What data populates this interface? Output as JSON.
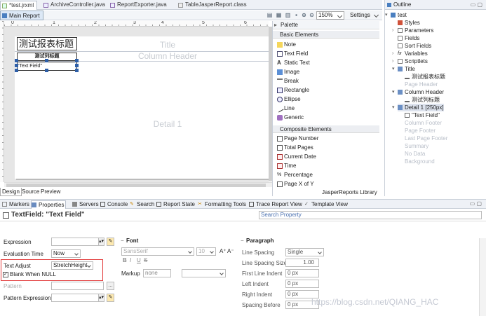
{
  "editor_tabs": [
    "*test.jrxml",
    "ArchiveController.java",
    "ReportExporter.java",
    "TableJasperReport.class"
  ],
  "sub_tab": "Main Report",
  "toolbar": {
    "zoom": "150%",
    "settings": "Settings"
  },
  "ruler": {
    "marks": [
      "0",
      "1",
      "2",
      "3",
      "4",
      "5",
      "6"
    ]
  },
  "report": {
    "title_text": "测试报表标题",
    "column_header_text": "测试列标题",
    "text_field": "\"Text Field\"",
    "bands": {
      "title": "Title",
      "column_header": "Column Header",
      "detail": "Detail 1"
    }
  },
  "bottom_tabs": [
    "Design",
    "Source",
    "Preview"
  ],
  "palette": {
    "header": "Palette",
    "basic_section": "Basic Elements",
    "basic": [
      "Note",
      "Text Field",
      "Static Text",
      "Image",
      "Break",
      "Rectangle",
      "Ellipse",
      "Line",
      "Generic"
    ],
    "composite_section": "Composite Elements",
    "composite": [
      "Page Number",
      "Total Pages",
      "Current Date",
      "Time",
      "Percentage",
      "Page X of Y"
    ],
    "footer": "JasperReports Library"
  },
  "outline": {
    "header": "Outline",
    "root": "test",
    "items": [
      "Styles",
      "Parameters",
      "Fields",
      "Sort Fields",
      "Variables",
      "Scriptlets",
      "Title",
      "测试报表标题",
      "Page Header",
      "Column Header",
      "测试列标题",
      "Detail 1 [250px]",
      "\"Text Field\"",
      "Column Footer",
      "Page Footer",
      "Last Page Footer",
      "Summary",
      "No Data",
      "Background"
    ]
  },
  "views": [
    "Markers",
    "Properties",
    "Servers",
    "Console",
    "Search",
    "Report State",
    "Formatting Tools",
    "Trace Report View",
    "Template View"
  ],
  "properties": {
    "title": "TextField: \"Text Field\"",
    "search_placeholder": "Search Property",
    "left": {
      "expression": "Expression",
      "eval_time": "Evaluation Time",
      "eval_time_value": "Now",
      "text_adjust": "Text Adjust",
      "text_adjust_value": "StretchHeight",
      "blank_when_null": "Blank When NULL",
      "blank_when_null_checked": true,
      "pattern": "Pattern",
      "pattern_expression": "Pattern Expression"
    },
    "font": {
      "section": "Font",
      "family": "SansSerif",
      "size": "10",
      "markup_label": "Markup",
      "markup_value": "none",
      "style_buttons": [
        "B",
        "I",
        "U",
        "S"
      ]
    },
    "paragraph": {
      "section": "Paragraph",
      "line_spacing": "Line Spacing",
      "line_spacing_value": "Single",
      "line_spacing_size": "Line Spacing Size",
      "line_spacing_size_value": "1.00",
      "first_line_indent": "First Line Indent",
      "left_indent": "Left Indent",
      "right_indent": "Right Indent",
      "spacing_before": "Spacing Before",
      "px_value": "0 px"
    }
  },
  "watermark": "https://blog.csdn.net/QIANG_HAC"
}
